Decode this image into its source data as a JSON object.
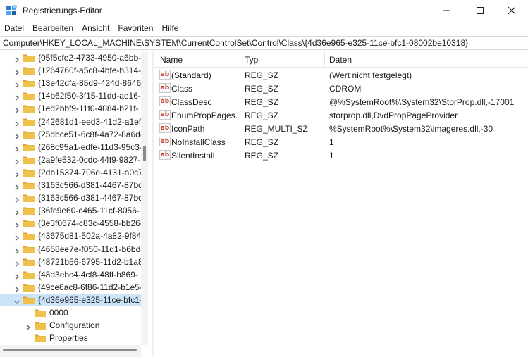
{
  "window": {
    "title": "Registrierungs-Editor"
  },
  "menu": [
    {
      "label": "Datei"
    },
    {
      "label": "Bearbeiten"
    },
    {
      "label": "Ansicht"
    },
    {
      "label": "Favoriten"
    },
    {
      "label": "Hilfe"
    }
  ],
  "address": {
    "path": "Computer\\HKEY_LOCAL_MACHINE\\SYSTEM\\CurrentControlSet\\Control\\Class\\{4d36e965-e325-11ce-bfc1-08002be10318}"
  },
  "tree": {
    "items": [
      {
        "label": "{05f5cfe2-4733-4950-a6bb-",
        "expanded": false,
        "selected": false
      },
      {
        "label": "{1264760f-a5c8-4bfe-b314-",
        "expanded": false,
        "selected": false
      },
      {
        "label": "{13e42dfa-85d9-424d-8646",
        "expanded": false,
        "selected": false
      },
      {
        "label": "{14b62f50-3f15-11dd-ae16-",
        "expanded": false,
        "selected": false
      },
      {
        "label": "{1ed2bbf9-11f0-4084-b21f-",
        "expanded": false,
        "selected": false
      },
      {
        "label": "{242681d1-eed3-41d2-a1ef-",
        "expanded": false,
        "selected": false
      },
      {
        "label": "{25dbce51-6c8f-4a72-8a6d-",
        "expanded": false,
        "selected": false
      },
      {
        "label": "{268c95a1-edfe-11d3-95c3-",
        "expanded": false,
        "selected": false
      },
      {
        "label": "{2a9fe532-0cdc-44f9-9827-",
        "expanded": false,
        "selected": false
      },
      {
        "label": "{2db15374-706e-4131-a0c7",
        "expanded": false,
        "selected": false
      },
      {
        "label": "{3163c566-d381-4467-87bc",
        "expanded": false,
        "selected": false
      },
      {
        "label": "{3163c566-d381-4467-87bc",
        "expanded": false,
        "selected": false
      },
      {
        "label": "{36fc9e60-c465-11cf-8056-",
        "expanded": false,
        "selected": false
      },
      {
        "label": "{3e3f0674-c83c-4558-bb26-",
        "expanded": false,
        "selected": false
      },
      {
        "label": "{43675d81-502a-4a82-9f84-",
        "expanded": false,
        "selected": false
      },
      {
        "label": "{4658ee7e-f050-11d1-b6bd",
        "expanded": false,
        "selected": false
      },
      {
        "label": "{48721b56-6795-11d2-b1a8",
        "expanded": false,
        "selected": false
      },
      {
        "label": "{48d3ebc4-4cf8-48ff-b869-",
        "expanded": false,
        "selected": false
      },
      {
        "label": "{49ce6ac8-6f86-11d2-b1e5-",
        "expanded": false,
        "selected": false
      },
      {
        "label": "{4d36e965-e325-11ce-bfc1-",
        "expanded": true,
        "selected": true
      }
    ],
    "children": [
      {
        "label": "0000",
        "has_children": false
      },
      {
        "label": "Configuration",
        "has_children": true
      },
      {
        "label": "Properties",
        "has_children": false
      }
    ]
  },
  "list": {
    "columns": [
      "Name",
      "Typ",
      "Daten"
    ],
    "rows": [
      {
        "name": "(Standard)",
        "type": "REG_SZ",
        "data": "(Wert nicht festgelegt)",
        "icon": "string-value-icon"
      },
      {
        "name": "Class",
        "type": "REG_SZ",
        "data": "CDROM",
        "icon": "string-value-icon"
      },
      {
        "name": "ClassDesc",
        "type": "REG_SZ",
        "data": "@%SystemRoot%\\System32\\StorProp.dll,-17001",
        "icon": "string-value-icon"
      },
      {
        "name": "EnumPropPages...",
        "type": "REG_SZ",
        "data": "storprop.dll,DvdPropPageProvider",
        "icon": "string-value-icon"
      },
      {
        "name": "IconPath",
        "type": "REG_MULTI_SZ",
        "data": "%SystemRoot%\\System32\\imageres.dll,-30",
        "icon": "string-value-icon"
      },
      {
        "name": "NoInstallClass",
        "type": "REG_SZ",
        "data": "1",
        "icon": "string-value-icon"
      },
      {
        "name": "SilentInstall",
        "type": "REG_SZ",
        "data": "1",
        "icon": "string-value-icon"
      }
    ],
    "icon_glyph": "ab"
  },
  "colors": {
    "selection": "#cce4f7",
    "folder": "#f0c14b",
    "folder_dark": "#dca52b"
  }
}
